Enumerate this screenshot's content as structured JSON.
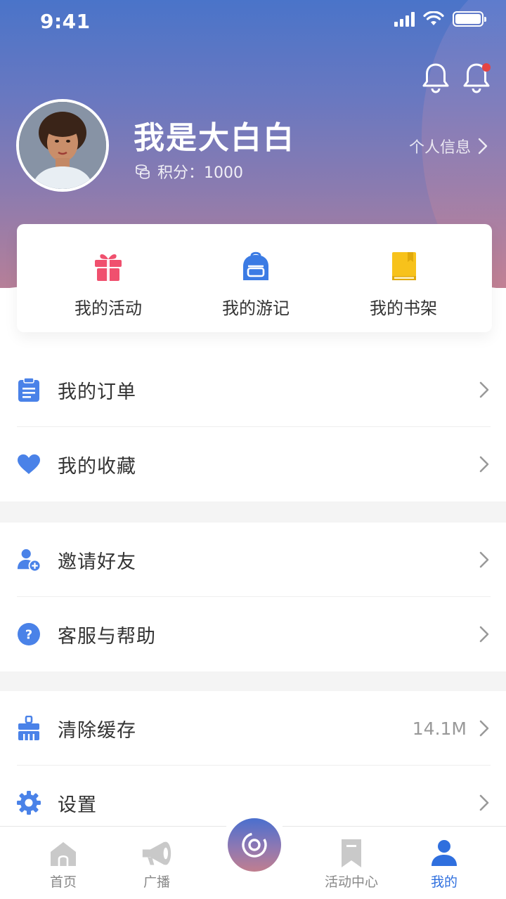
{
  "status_bar": {
    "time": "9:41"
  },
  "profile": {
    "name": "我是大白白",
    "points_label": "积分：",
    "points_value": "1000",
    "info_link": "个人信息"
  },
  "quick_actions": [
    {
      "label": "我的活动",
      "icon": "gift-icon",
      "color": "#f0506e"
    },
    {
      "label": "我的游记",
      "icon": "backpack-icon",
      "color": "#3b7be4"
    },
    {
      "label": "我的书架",
      "icon": "book-icon",
      "color": "#f7c21b"
    }
  ],
  "menu_groups": [
    [
      {
        "label": "我的订单",
        "icon": "clipboard-icon"
      },
      {
        "label": "我的收藏",
        "icon": "heart-icon"
      }
    ],
    [
      {
        "label": "邀请好友",
        "icon": "add-user-icon"
      },
      {
        "label": "客服与帮助",
        "icon": "help-icon"
      }
    ],
    [
      {
        "label": "清除缓存",
        "icon": "broom-icon",
        "value": "14.1M"
      },
      {
        "label": "设置",
        "icon": "gear-icon"
      }
    ]
  ],
  "tabbar": {
    "tabs": [
      {
        "label": "首页",
        "icon": "home-icon"
      },
      {
        "label": "广播",
        "icon": "megaphone-icon"
      },
      {
        "label": "活动中心",
        "icon": "bookmark-icon"
      },
      {
        "label": "我的",
        "icon": "user-icon",
        "active": true
      }
    ],
    "center_icon": "camera-lens-icon"
  },
  "colors": {
    "accent": "#2f6fde",
    "menu_icon": "#4a82e8",
    "notification_dot": "#e54343"
  }
}
